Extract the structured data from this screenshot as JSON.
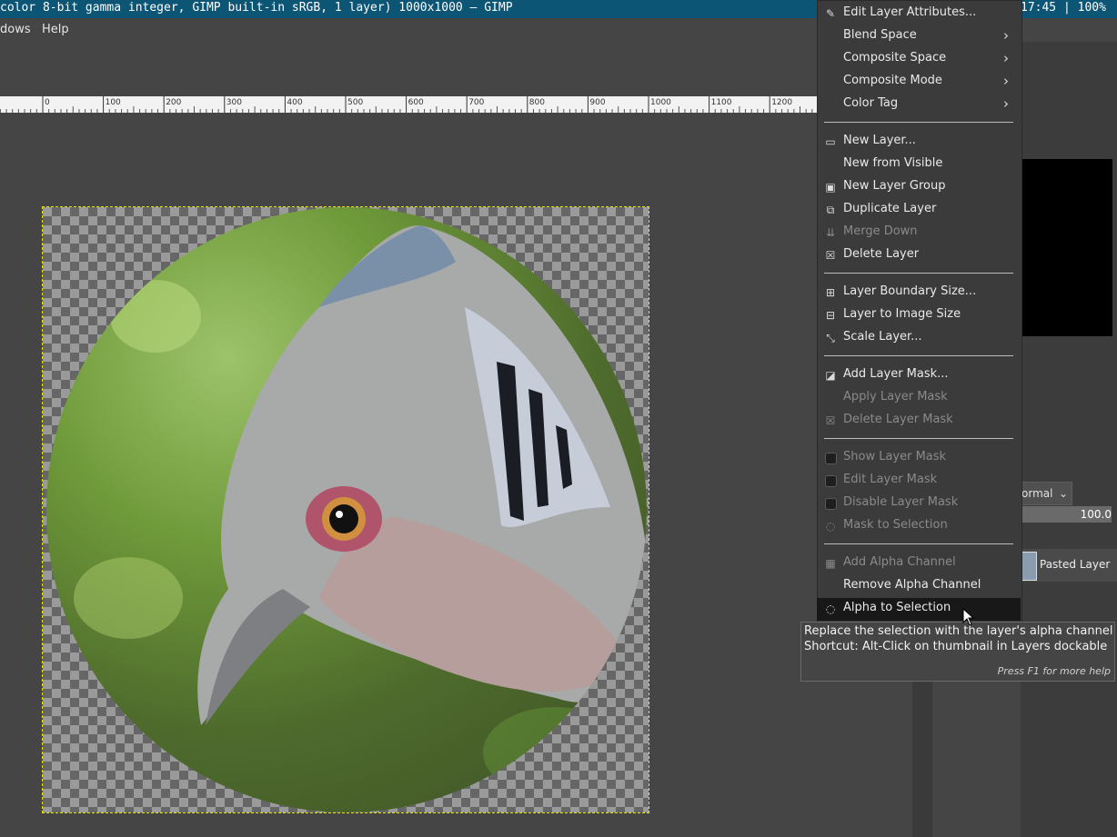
{
  "window": {
    "title": "color 8-bit gamma integer, GIMP built-in sRGB, 1 layer) 1000x1000 – GIMP",
    "clock": "17:45 | 100%"
  },
  "menubar": {
    "windows": "dows",
    "help": "Help"
  },
  "ruler": {
    "ticks": [
      "0",
      "100",
      "200",
      "300",
      "400",
      "500",
      "600",
      "700",
      "800",
      "900",
      "1000",
      "1100",
      "1200"
    ]
  },
  "layers_panel": {
    "mode": "ormal",
    "opacity": "100.0",
    "layer_name": "Pasted Layer"
  },
  "context_menu": {
    "items": [
      {
        "label": "Edit Layer Attributes...",
        "icon": "edit-attributes-icon",
        "enabled": true,
        "submenu": false
      },
      {
        "label": "Blend Space",
        "icon": "",
        "enabled": true,
        "submenu": true
      },
      {
        "label": "Composite Space",
        "icon": "",
        "enabled": true,
        "submenu": true
      },
      {
        "label": "Composite Mode",
        "icon": "",
        "enabled": true,
        "submenu": true
      },
      {
        "label": "Color Tag",
        "icon": "",
        "enabled": true,
        "submenu": true
      },
      {
        "label": "New Layer...",
        "icon": "new-layer-icon",
        "enabled": true,
        "submenu": false
      },
      {
        "label": "New from Visible",
        "icon": "",
        "enabled": true,
        "submenu": false
      },
      {
        "label": "New Layer Group",
        "icon": "new-layer-group-icon",
        "enabled": true,
        "submenu": false
      },
      {
        "label": "Duplicate Layer",
        "icon": "duplicate-layer-icon",
        "enabled": true,
        "submenu": false
      },
      {
        "label": "Merge Down",
        "icon": "merge-down-icon",
        "enabled": false,
        "submenu": false
      },
      {
        "label": "Delete Layer",
        "icon": "delete-layer-icon",
        "enabled": true,
        "submenu": false
      },
      {
        "label": "Layer Boundary Size...",
        "icon": "layer-boundary-icon",
        "enabled": true,
        "submenu": false
      },
      {
        "label": "Layer to Image Size",
        "icon": "layer-to-image-icon",
        "enabled": true,
        "submenu": false
      },
      {
        "label": "Scale Layer...",
        "icon": "scale-layer-icon",
        "enabled": true,
        "submenu": false
      },
      {
        "label": "Add Layer Mask...",
        "icon": "add-mask-icon",
        "enabled": true,
        "submenu": false
      },
      {
        "label": "Apply Layer Mask",
        "icon": "",
        "enabled": false,
        "submenu": false
      },
      {
        "label": "Delete Layer Mask",
        "icon": "delete-mask-icon",
        "enabled": false,
        "submenu": false
      },
      {
        "label": "Show Layer Mask",
        "icon": "checkbox",
        "enabled": false,
        "submenu": false
      },
      {
        "label": "Edit Layer Mask",
        "icon": "checkbox",
        "enabled": false,
        "submenu": false
      },
      {
        "label": "Disable Layer Mask",
        "icon": "checkbox",
        "enabled": false,
        "submenu": false
      },
      {
        "label": "Mask to Selection",
        "icon": "mask-selection-icon",
        "enabled": false,
        "submenu": false
      },
      {
        "label": "Add Alpha Channel",
        "icon": "alpha-channel-icon",
        "enabled": false,
        "submenu": false
      },
      {
        "label": "Remove Alpha Channel",
        "icon": "",
        "enabled": true,
        "submenu": false
      },
      {
        "label": "Alpha to Selection",
        "icon": "alpha-selection-icon",
        "enabled": true,
        "submenu": false,
        "hover": true
      }
    ]
  },
  "tooltip": {
    "line1": "Replace the selection with the layer's alpha channel",
    "line2": "Shortcut: Alt-Click on thumbnail in Layers dockable",
    "help": "Press F1 for more help"
  }
}
